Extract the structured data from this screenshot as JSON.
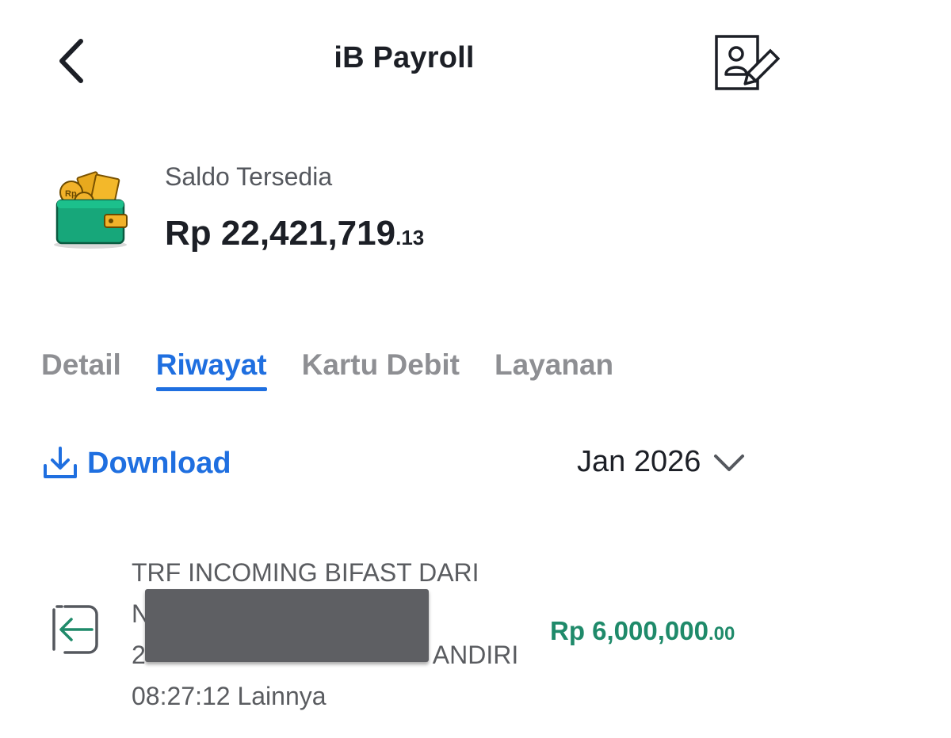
{
  "header": {
    "title": "iB Payroll"
  },
  "balance": {
    "label": "Saldo Tersedia",
    "amount_main": "Rp 22,421,719",
    "amount_cents": ".13"
  },
  "tabs": [
    {
      "label": "Detail",
      "active": false
    },
    {
      "label": "Riwayat",
      "active": true
    },
    {
      "label": "Kartu Debit",
      "active": false
    },
    {
      "label": "Layanan",
      "active": false
    }
  ],
  "toolbar": {
    "download_label": "Download",
    "month": "Jan 2026"
  },
  "transactions": [
    {
      "line1": "TRF INCOMING BIFAST DARI",
      "line2": "N",
      "line3_start": "2",
      "line3_end": "ANDIRI",
      "line4": "08:27:12 Lainnya",
      "amount_main": "Rp 6,000,000",
      "amount_cents": ".00"
    }
  ],
  "colors": {
    "accent": "#1f6fe0",
    "credit": "#1f8a6a",
    "wallet_green": "#17a77a"
  },
  "icons": {
    "back": "chevron-left-icon",
    "edit_profile": "edit-profile-icon",
    "wallet": "wallet-icon",
    "download": "download-icon",
    "month_dropdown": "chevron-down-icon",
    "incoming": "incoming-transfer-icon"
  }
}
